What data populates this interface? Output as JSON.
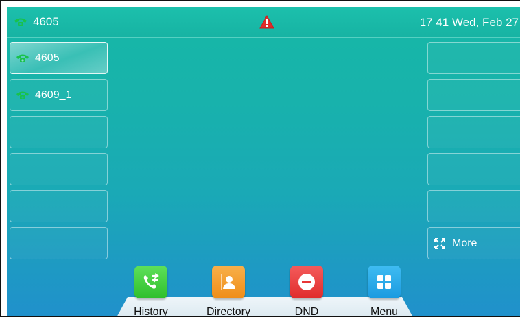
{
  "status_bar": {
    "account": "4605",
    "datetime": "17 41 Wed, Feb 27"
  },
  "line_keys_left": [
    {
      "label": "4605",
      "icon": "phone-icon",
      "active": true
    },
    {
      "label": "4609_1",
      "icon": "phone-icon",
      "active": false
    },
    {
      "label": ""
    },
    {
      "label": ""
    },
    {
      "label": ""
    },
    {
      "label": ""
    }
  ],
  "line_keys_right": [
    {
      "label": ""
    },
    {
      "label": ""
    },
    {
      "label": ""
    },
    {
      "label": ""
    },
    {
      "label": ""
    },
    {
      "label": "More",
      "icon": "expand-icon"
    }
  ],
  "softkeys": [
    {
      "label": "History",
      "icon": "call-history-icon",
      "color": "#3ccf3a"
    },
    {
      "label": "Directory",
      "icon": "contact-icon",
      "color": "#f39a25"
    },
    {
      "label": "DND",
      "icon": "do-not-disturb-icon",
      "color": "#ea3b3b"
    },
    {
      "label": "Menu",
      "icon": "menu-grid-icon",
      "color": "#25a7e6"
    }
  ],
  "colors": {
    "phone_icon": "#19c24a",
    "warning": "#e02a2a"
  }
}
